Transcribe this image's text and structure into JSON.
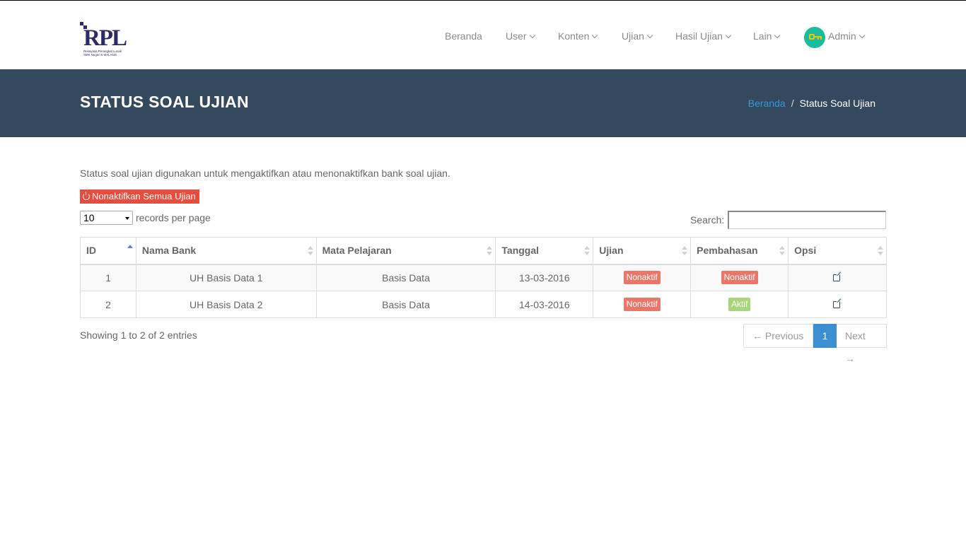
{
  "brand": {
    "logo_text": "RPL",
    "logo_subtitle_1": "Rekayasa Perangkat Lunak",
    "logo_subtitle_2": "SMK Negeri 5 MALANG"
  },
  "nav": {
    "items": [
      "Beranda",
      "User",
      "Konten",
      "Ujian",
      "Hasil Ujian",
      "Lain"
    ],
    "user": "Admin"
  },
  "header": {
    "title": "STATUS SOAL UJIAN",
    "breadcrumb": {
      "home": "Beranda",
      "separator": "/",
      "current": "Status Soal Ujian"
    }
  },
  "content": {
    "description": "Status soal ujian digunakan untuk mengaktifkan atau menonaktifkan bank soal ujian.",
    "deactivate_all_label": "Nonaktifkan Semua Ujian",
    "page_length": "10",
    "page_length_label": "records per page",
    "search_label": "Search:",
    "search_value": ""
  },
  "table": {
    "columns": [
      "ID",
      "Nama Bank",
      "Mata Pelajaran",
      "Tanggal",
      "Ujian",
      "Pembahasan",
      "Opsi"
    ],
    "rows": [
      {
        "id": "1",
        "nama_bank": "UH Basis Data 1",
        "mata_pelajaran": "Basis Data",
        "tanggal": "13-03-2016",
        "ujian": "Nonaktif",
        "pembahasan": "Nonaktif"
      },
      {
        "id": "2",
        "nama_bank": "UH Basis Data 2",
        "mata_pelajaran": "Basis Data",
        "tanggal": "14-03-2016",
        "ujian": "Nonaktif",
        "pembahasan": "Aktif"
      }
    ]
  },
  "footer": {
    "showing": "Showing 1 to 2 of 2 entries",
    "prev": "← Previous",
    "page": "1",
    "next": "Next →"
  },
  "colors": {
    "header_band": "#34495e",
    "danger": "#e74c3c",
    "badge_inactive": "#e8776a",
    "badge_active": "#a8d57a",
    "link": "#3498db",
    "pager_active": "#3b8fd0"
  },
  "icons": {
    "deactivate": "power-icon",
    "row_action": "edit-icon",
    "avatar": "key-icon"
  }
}
